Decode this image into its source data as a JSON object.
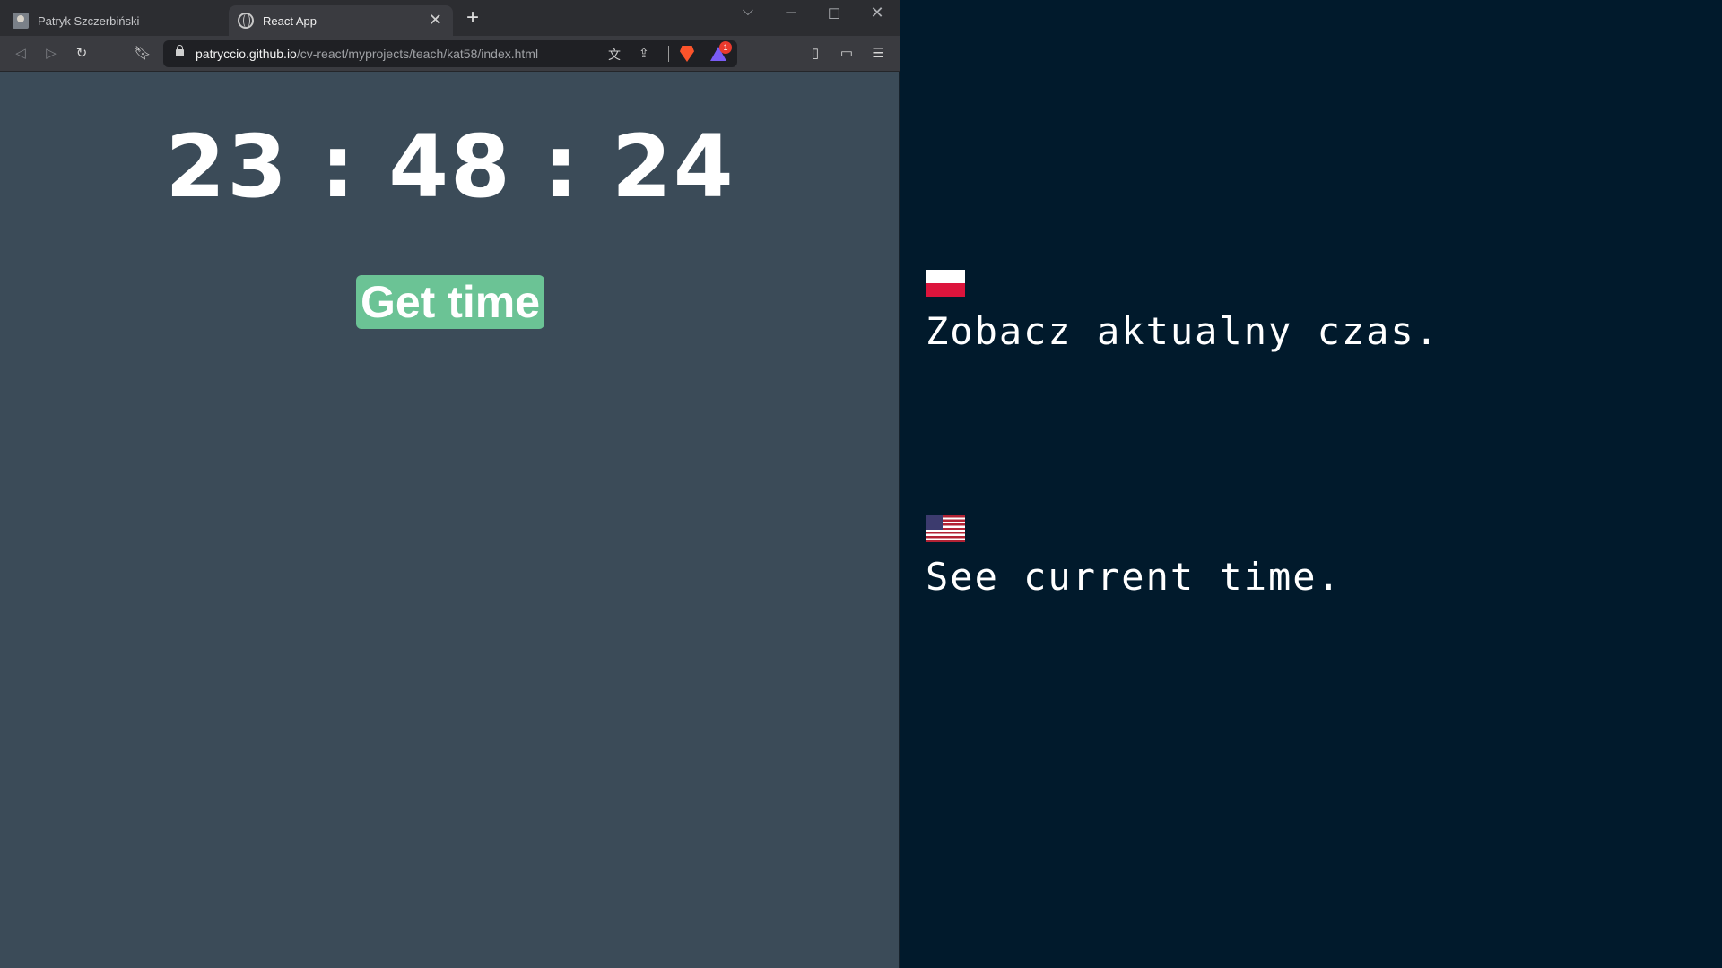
{
  "browser": {
    "tabs": [
      {
        "title": "Patryk Szczerbiński",
        "active": false
      },
      {
        "title": "React App",
        "active": true
      }
    ],
    "tab_close_glyph": "✕",
    "new_tab_glyph": "+",
    "url_host": "patryccio.github.io",
    "url_path": "/cv-react/myprojects/teach/kat58/index.html",
    "rewards_badge": "1"
  },
  "app": {
    "clock": "23 : 48 : 24",
    "button_label": "Get time",
    "accent_color": "#6bc395"
  },
  "panel": {
    "pl_caption": "Zobacz aktualny czas.",
    "en_caption": "See current time."
  },
  "icons": [
    "back-icon",
    "forward-icon",
    "reload-icon",
    "bookmark-icon",
    "lock-icon",
    "translate-icon",
    "share-icon",
    "brave-shields-icon",
    "brave-rewards-icon",
    "sidebar-icon",
    "wallet-icon",
    "menu-icon",
    "polish-flag-icon",
    "us-flag-icon"
  ]
}
